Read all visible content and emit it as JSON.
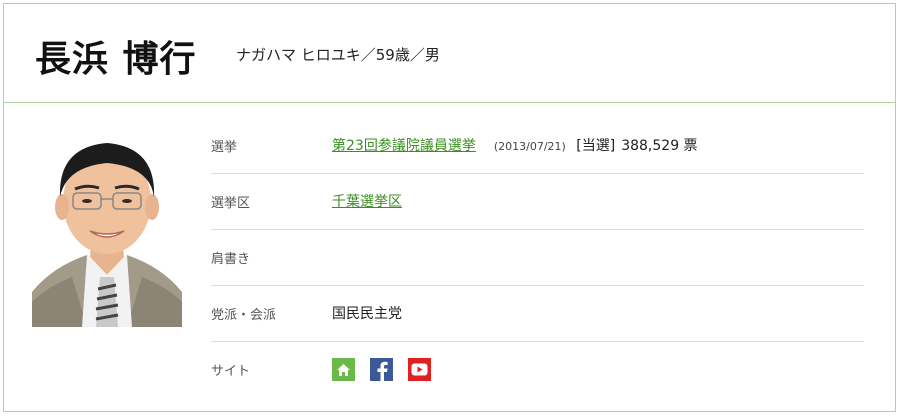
{
  "profile": {
    "name": "長浜 博行",
    "reading_age_gender": "ナガハマ ヒロユキ／59歳／男"
  },
  "rows": {
    "election": {
      "label": "選挙",
      "link": "第23回参議院議員選挙",
      "date": "(2013/07/21)",
      "result": "[当選]",
      "votes": "388,529 票"
    },
    "district": {
      "label": "選挙区",
      "link": "千葉選挙区"
    },
    "title": {
      "label": "肩書き",
      "value": ""
    },
    "party": {
      "label": "党派・会派",
      "value": "国民民主党"
    },
    "site": {
      "label": "サイト",
      "icons": [
        "home-icon",
        "facebook-icon",
        "youtube-icon"
      ]
    }
  },
  "colors": {
    "border": "#a9d49a",
    "link": "#3a8f1f",
    "home": "#6ab94a",
    "facebook": "#3b5998",
    "youtube": "#e02121"
  }
}
